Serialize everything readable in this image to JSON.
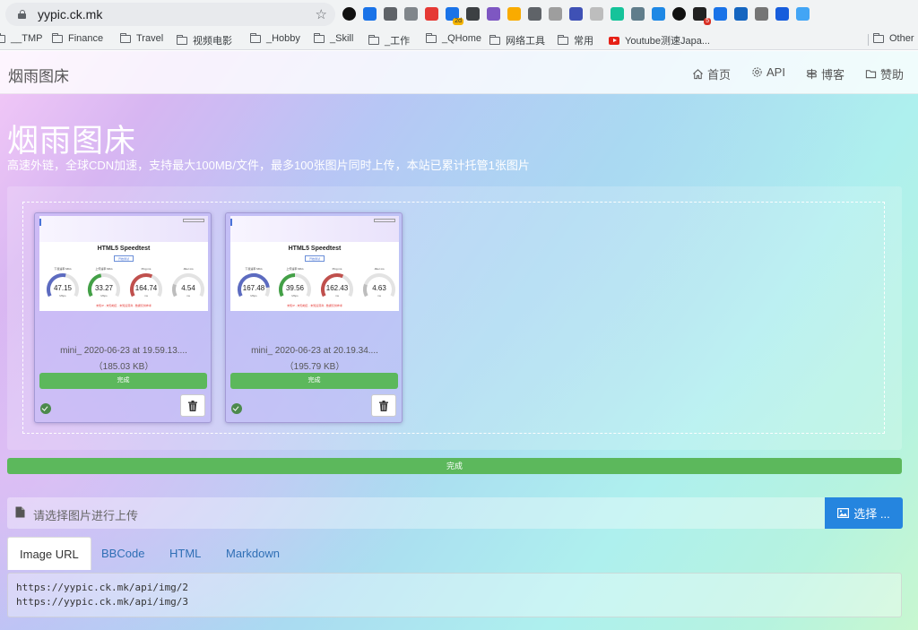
{
  "browser": {
    "url": "yypic.ck.mk",
    "extensions": [
      {
        "icon": "circle-ext-icon",
        "color": "#111111"
      },
      {
        "icon": "bookmark-ext-icon",
        "color": "#1a73e8"
      },
      {
        "icon": "pocket-ext-icon",
        "color": "#5f6368"
      },
      {
        "icon": "copy-ext-icon",
        "color": "#80868b"
      },
      {
        "icon": "stop-ext-icon",
        "color": "#e53935"
      },
      {
        "icon": "calendar-ext-icon",
        "color": "#1a73e8",
        "badge": "2d"
      },
      {
        "icon": "search-ext-icon",
        "color": "#3c4043"
      },
      {
        "icon": "purple-ext-icon",
        "color": "#7e57c2"
      },
      {
        "icon": "note-ext-icon",
        "color": "#f9ab00"
      },
      {
        "icon": "wave-ext-icon",
        "color": "#5f6368"
      },
      {
        "icon": "image-ext-icon",
        "color": "#9e9e9e"
      },
      {
        "icon": "download-ext-icon",
        "color": "#3f51b5"
      },
      {
        "icon": "spinner-ext-icon",
        "color": "#bdbdbd"
      },
      {
        "icon": "grammarly-ext-icon",
        "color": "#15c39a"
      },
      {
        "icon": "photo-ext-icon",
        "color": "#607d8b"
      },
      {
        "icon": "lens-ext-icon",
        "color": "#1e88e5"
      },
      {
        "icon": "vd-ext-icon",
        "color": "#111111"
      },
      {
        "icon": "dark-ext-icon",
        "color": "#212121",
        "badge": "5"
      },
      {
        "icon": "check-ext-icon",
        "color": "#1a73e8"
      },
      {
        "icon": "grid-ext-icon",
        "color": "#1565c0"
      },
      {
        "icon": "save-ext-icon",
        "color": "#757575"
      },
      {
        "icon": "bitwarden-ext-icon",
        "color": "#175ddc"
      },
      {
        "icon": "paper-plane-ext-icon",
        "color": "#42a5f5"
      }
    ],
    "bookmarks": [
      {
        "label": "__TMP",
        "type": "folder"
      },
      {
        "label": "Finance",
        "type": "folder"
      },
      {
        "label": "Travel",
        "type": "folder"
      },
      {
        "label": "视频电影",
        "type": "folder"
      },
      {
        "label": "_Hobby",
        "type": "folder"
      },
      {
        "label": "_Skill",
        "type": "folder"
      },
      {
        "label": "_工作",
        "type": "folder"
      },
      {
        "label": "_QHome",
        "type": "folder"
      },
      {
        "label": "网络工具",
        "type": "folder"
      },
      {
        "label": "常用",
        "type": "folder"
      },
      {
        "label": "Youtube测速Japa...",
        "type": "youtube"
      },
      {
        "label": "Other",
        "type": "folder"
      }
    ]
  },
  "navbar": {
    "brand": "烟雨图床",
    "items": [
      {
        "label": "首页",
        "icon": "home-icon"
      },
      {
        "label": "API",
        "icon": "gear-icon"
      },
      {
        "label": "博客",
        "icon": "signpost-icon"
      },
      {
        "label": "赞助",
        "icon": "folder-icon"
      }
    ]
  },
  "hero": {
    "title": "烟雨图床",
    "subtitle": "高速外链，全球CDN加速，支持最大100MB/文件，最多100张图片同时上传，本站已累计托管1张图片"
  },
  "uploads": [
    {
      "filename": "mini_ 2020-06-23 at 19.59.13....",
      "size": "（185.03 KB）",
      "status": "完成",
      "preview": {
        "title": "HTML5 Speedtest",
        "button": "开始测试",
        "gauges": [
          {
            "label": "下载速率 Mb/s",
            "value": "47.15",
            "unit": "Mbps",
            "color": "#5c6bc0",
            "fraction": 0.55
          },
          {
            "label": "上传速率 Mb/s",
            "value": "33.27",
            "unit": "Mbps",
            "color": "#43a047",
            "fraction": 0.45
          },
          {
            "label": "Ping ms",
            "value": "164.74",
            "unit": "ms",
            "color": "#c0504d",
            "fraction": 0.6
          },
          {
            "label": "Jitter ms",
            "value": "4.54",
            "unit": "ms",
            "color": "#bdbdbd",
            "fraction": 0.2
          }
        ],
        "footer": "未知IP - 未知地区 - 未知运营商 - 数据仅供参考"
      }
    },
    {
      "filename": "mini_ 2020-06-23 at 20.19.34....",
      "size": "（195.79 KB）",
      "status": "完成",
      "preview": {
        "title": "HTML5 Speedtest",
        "button": "开始测试",
        "gauges": [
          {
            "label": "下载速率 Mb/s",
            "value": "167.48",
            "unit": "Mbps",
            "color": "#5c6bc0",
            "fraction": 0.85
          },
          {
            "label": "上传速率 Mb/s",
            "value": "39.56",
            "unit": "Mbps",
            "color": "#43a047",
            "fraction": 0.5
          },
          {
            "label": "Ping ms",
            "value": "162.43",
            "unit": "ms",
            "color": "#c0504d",
            "fraction": 0.6
          },
          {
            "label": "Jitter ms",
            "value": "4.63",
            "unit": "ms",
            "color": "#bdbdbd",
            "fraction": 0.2
          }
        ],
        "footer": "未知IP - 未知地区 - 未知运营商 - 数据仅供参考"
      }
    }
  ],
  "progress": {
    "label": "完成",
    "percent": 100
  },
  "file_input": {
    "placeholder": "请选择图片进行上传",
    "button": "选择 ..."
  },
  "tabs": [
    {
      "label": "Image URL",
      "active": true
    },
    {
      "label": "BBCode",
      "active": false
    },
    {
      "label": "HTML",
      "active": false
    },
    {
      "label": "Markdown",
      "active": false
    }
  ],
  "links": [
    "https://yypic.ck.mk/api/img/2",
    "https://yypic.ck.mk/api/img/3"
  ],
  "colors": {
    "success": "#5cb85c",
    "primary": "#2585df",
    "link": "#2f6fb5"
  }
}
